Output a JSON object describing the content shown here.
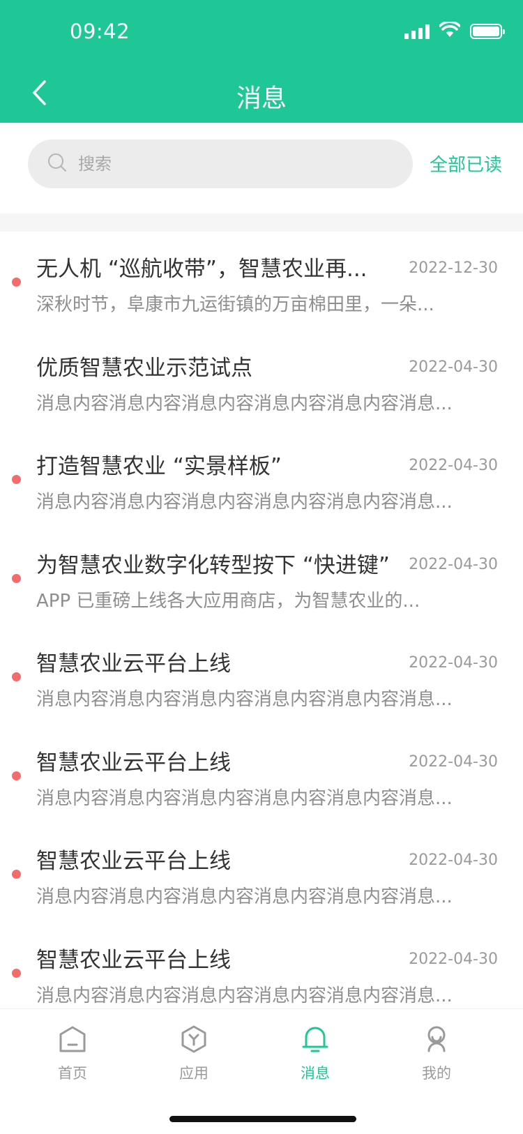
{
  "status_bar": {
    "time": "09:42"
  },
  "header": {
    "title": "消息"
  },
  "search": {
    "placeholder": "搜索",
    "mark_all_read": "全部已读"
  },
  "messages": [
    {
      "title": "无人机 “巡航收带”，智慧农业再...",
      "date": "2022-12-30",
      "preview": "深秋时节，阜康市九运街镇的万亩棉田里，一朵...",
      "unread": true
    },
    {
      "title": "优质智慧农业示范试点",
      "date": "2022-04-30",
      "preview": "消息内容消息内容消息内容消息内容消息内容消息...",
      "unread": false
    },
    {
      "title": "打造智慧农业 “实景样板”",
      "date": "2022-04-30",
      "preview": "消息内容消息内容消息内容消息内容消息内容消息...",
      "unread": true
    },
    {
      "title": "为智慧农业数字化转型按下 “快进键”",
      "date": "2022-04-30",
      "preview": " APP 已重磅上线各大应用商店，为智慧农业的...",
      "unread": true
    },
    {
      "title": "智慧农业云平台上线",
      "date": "2022-04-30",
      "preview": "消息内容消息内容消息内容消息内容消息内容消息...",
      "unread": true
    },
    {
      "title": "智慧农业云平台上线",
      "date": "2022-04-30",
      "preview": "消息内容消息内容消息内容消息内容消息内容消息...",
      "unread": true
    },
    {
      "title": "智慧农业云平台上线",
      "date": "2022-04-30",
      "preview": "消息内容消息内容消息内容消息内容消息内容消息...",
      "unread": true
    },
    {
      "title": "智慧农业云平台上线",
      "date": "2022-04-30",
      "preview": "消息内容消息内容消息内容消息内容消息内容消息...",
      "unread": true
    }
  ],
  "tabbar": {
    "home": "首页",
    "apps": "应用",
    "messages": "消息",
    "mine": "我的",
    "active": "messages"
  },
  "colors": {
    "accent": "#1fc796",
    "unread_dot": "#f56b6b",
    "inactive": "#9a9a9a"
  }
}
